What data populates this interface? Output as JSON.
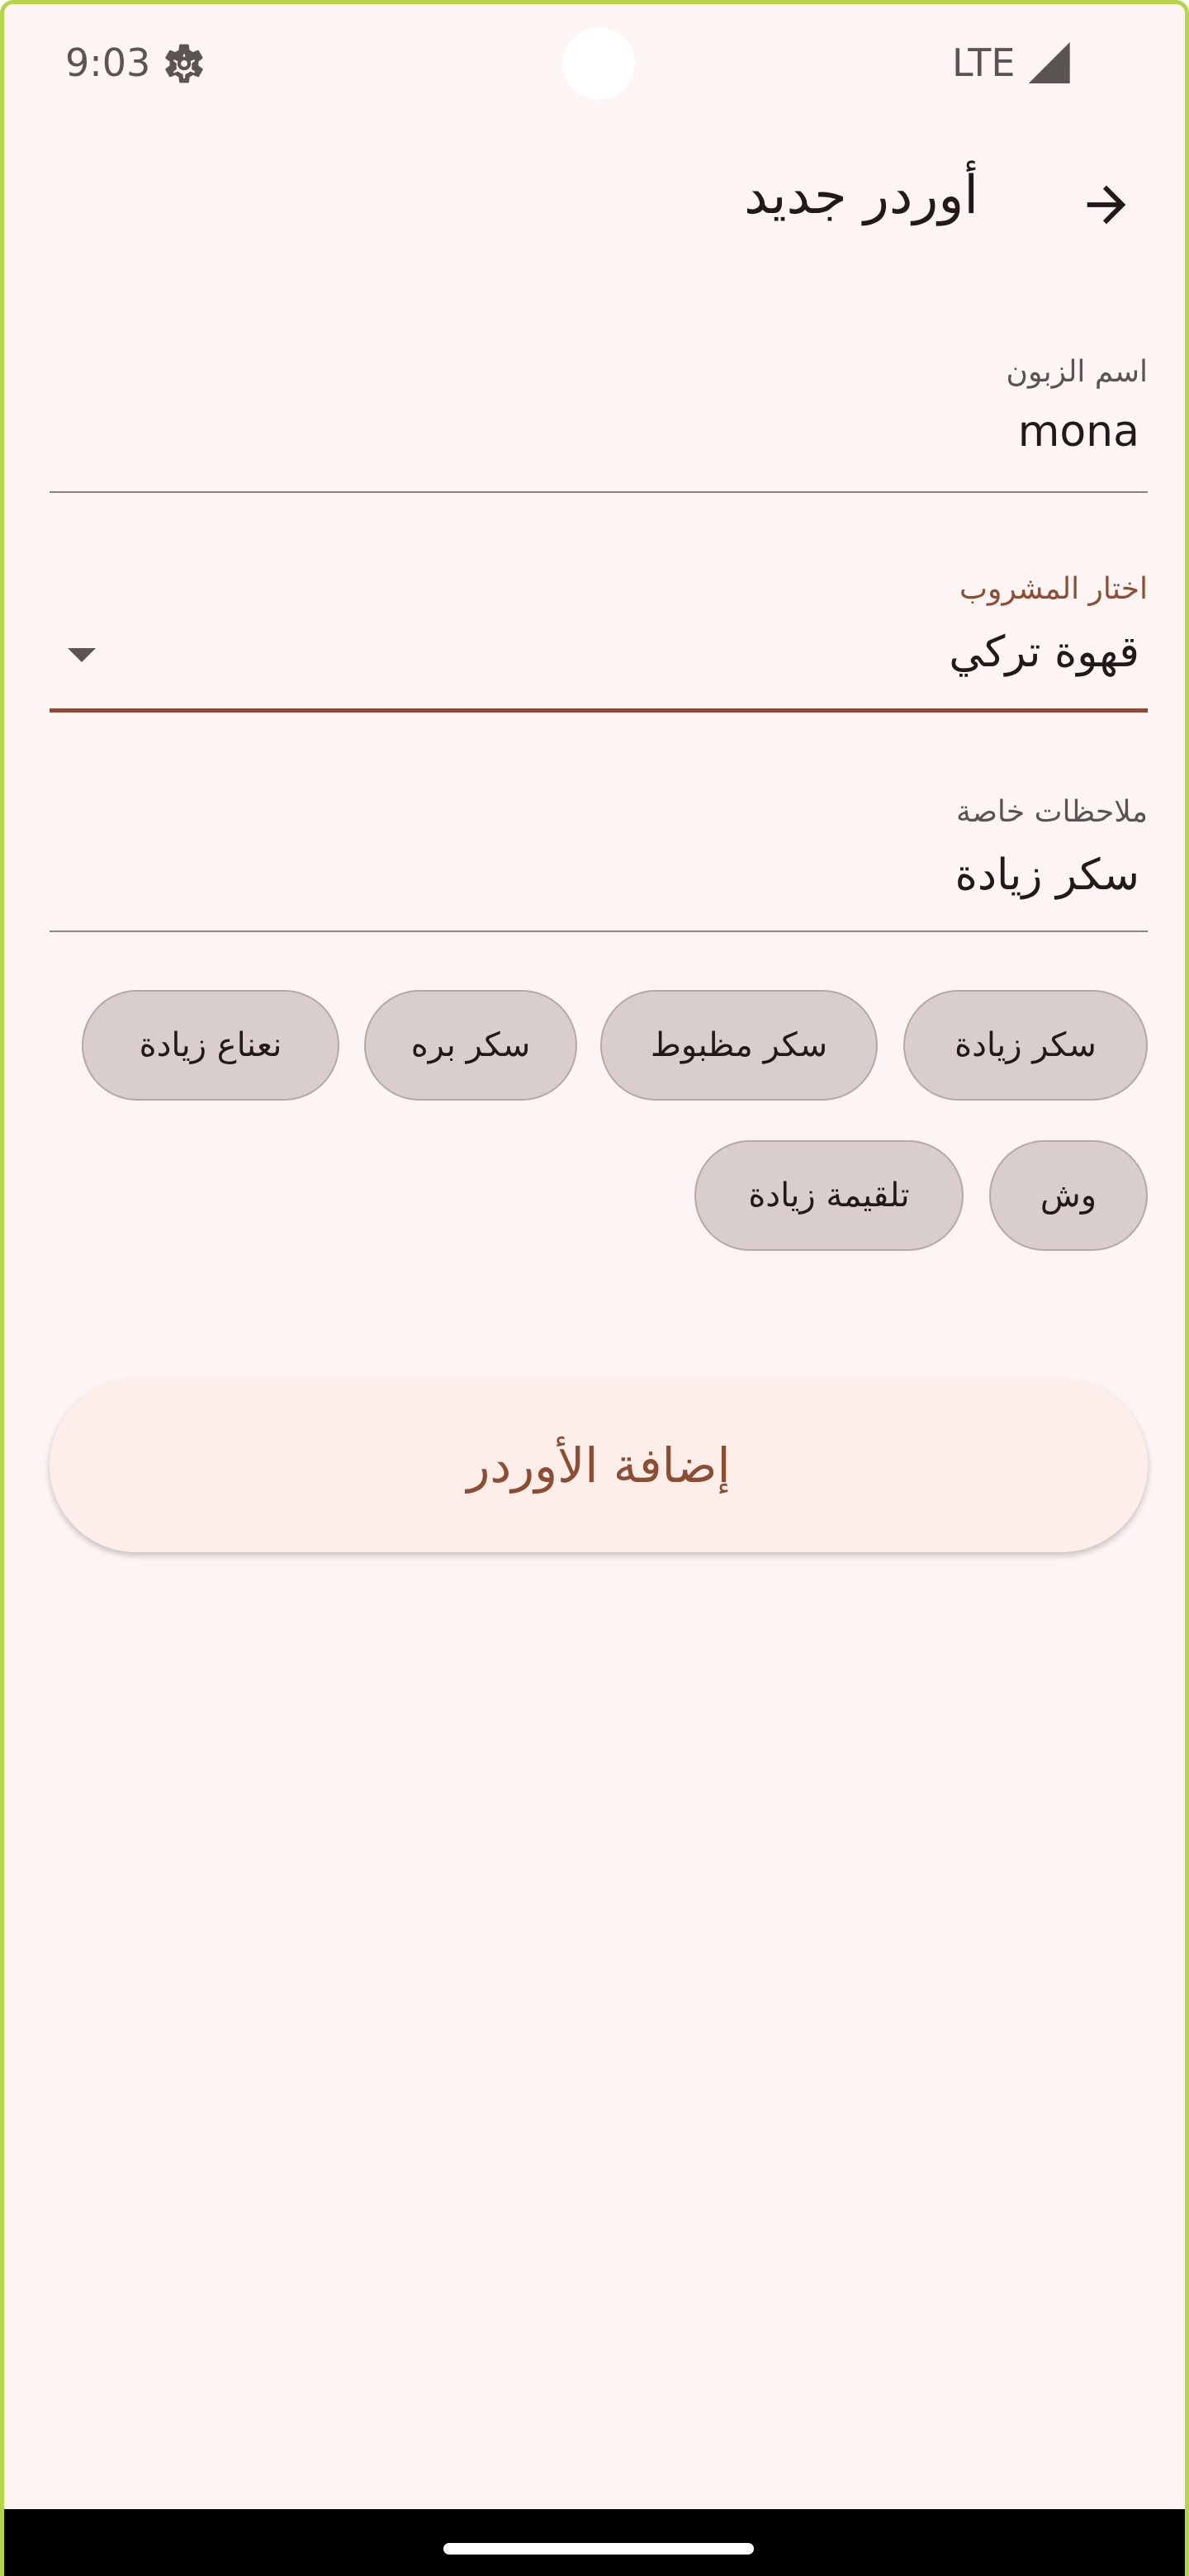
{
  "status_bar": {
    "time": "9:03",
    "network": "LTE",
    "settings_icon": "gear-icon",
    "signal_icon": "signal-icon"
  },
  "toolbar": {
    "title": "أوردر جديد",
    "back_icon": "arrow-back-icon"
  },
  "form": {
    "customer_name": {
      "label": "اسم الزبون",
      "value": "mona"
    },
    "drink": {
      "label": "اختار المشروب",
      "value": "قهوة تركي",
      "accent_color": "#8d4d33"
    },
    "notes": {
      "label": "ملاحظات خاصة",
      "value": "سكر زيادة"
    }
  },
  "chips": [
    {
      "label": "سكر زيادة"
    },
    {
      "label": "سكر مظبوط"
    },
    {
      "label": "سكر بره"
    },
    {
      "label": "نعناع زيادة"
    },
    {
      "label": "وش"
    },
    {
      "label": "تلقيمة زيادة"
    }
  ],
  "actions": {
    "add_order_label": "إضافة الأوردر"
  },
  "colors": {
    "background": "#fdf5f3",
    "accent": "#8d4d33",
    "chip_background": "#d9cecb",
    "button_background": "#fdeee9"
  }
}
